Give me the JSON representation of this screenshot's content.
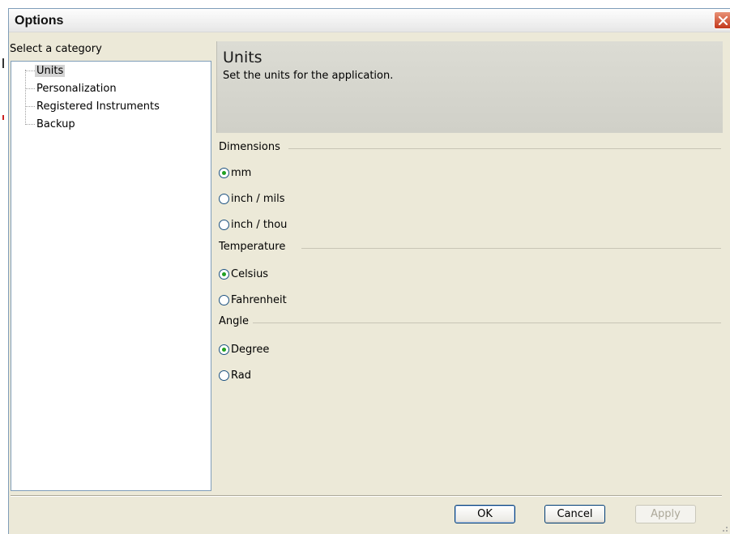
{
  "window": {
    "title": "Options"
  },
  "sidebar": {
    "label": "Select a category",
    "items": [
      {
        "label": "Units",
        "selected": true
      },
      {
        "label": "Personalization",
        "selected": false
      },
      {
        "label": "Registered Instruments",
        "selected": false
      },
      {
        "label": "Backup",
        "selected": false
      }
    ]
  },
  "header": {
    "title": "Units",
    "description": "Set the units for the application."
  },
  "groups": {
    "dimensions": {
      "label": "Dimensions",
      "options": [
        "mm",
        "inch / mils",
        "inch / thou"
      ],
      "selected": "mm"
    },
    "temperature": {
      "label": "Temperature",
      "options": [
        "Celsius",
        "Fahrenheit"
      ],
      "selected": "Celsius"
    },
    "angle": {
      "label": "Angle",
      "options": [
        "Degree",
        "Rad"
      ],
      "selected": "Degree"
    }
  },
  "buttons": {
    "ok": "OK",
    "cancel": "Cancel",
    "apply": "Apply",
    "apply_enabled": false
  },
  "colors": {
    "close_button": "#c2381c",
    "radio_dot": "#21a121",
    "header_bg": "#d6d6ce"
  }
}
